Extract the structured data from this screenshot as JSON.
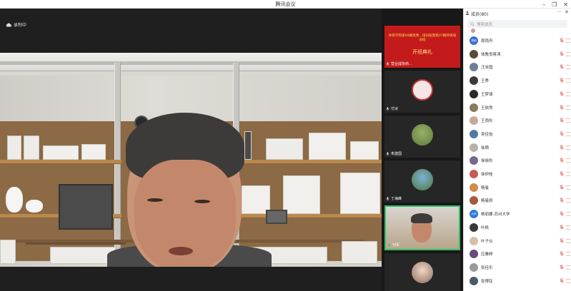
{
  "window": {
    "title": "腾讯会议"
  },
  "main": {
    "recording_label": "录制中"
  },
  "strip": {
    "tiles": [
      {
        "name": "营业成协商…",
        "banner_text": "体育学院第69期优秀…培训班暨第47期师资培训班",
        "banner_ceremony": "开班典礼"
      },
      {
        "name": "付冰"
      },
      {
        "name": "朱建国"
      },
      {
        "name": "丁海峰"
      },
      {
        "name": "刘军"
      },
      {
        "name": ""
      }
    ]
  },
  "panel": {
    "title": "成员(80)",
    "search_placeholder": "搜索成员",
    "members": [
      {
        "name": "周雨舟",
        "avatar_text": "周雨",
        "color": "#3a6fd8"
      },
      {
        "name": "体教员蒋涛",
        "avatar_text": "",
        "color": "#5a4a3a"
      },
      {
        "name": "汪米国",
        "avatar_text": "",
        "color": "#6a7f95"
      },
      {
        "name": "王秀",
        "avatar_text": "",
        "color": "#3a3a3a"
      },
      {
        "name": "王梦琦",
        "avatar_text": "",
        "color": "#2a2a2a"
      },
      {
        "name": "王依然",
        "avatar_text": "",
        "color": "#8c7a62"
      },
      {
        "name": "王雨彤",
        "avatar_text": "",
        "color": "#c9a89a"
      },
      {
        "name": "吴佳怡",
        "avatar_text": "",
        "color": "#4f7aa5"
      },
      {
        "name": "徐萌",
        "avatar_text": "",
        "color": "#b9b2a8"
      },
      {
        "name": "徐晓彤",
        "avatar_text": "",
        "color": "#7a6a8a"
      },
      {
        "name": "徐伊桂",
        "avatar_text": "",
        "color": "#c55a5a"
      },
      {
        "name": "杨曼",
        "avatar_text": "",
        "color": "#d08a4a"
      },
      {
        "name": "杨曼原",
        "avatar_text": "",
        "color": "#a55a3a"
      },
      {
        "name": "杨丽娜-苏州大学",
        "avatar_text": "大学",
        "color": "#2b7bd6"
      },
      {
        "name": "叶帆",
        "avatar_text": "",
        "color": "#3a3a3a"
      },
      {
        "name": "叶子仪",
        "avatar_text": "",
        "color": "#d7c0a8"
      },
      {
        "name": "应雅婷",
        "avatar_text": "",
        "color": "#6a4a7a"
      },
      {
        "name": "张佳乐",
        "avatar_text": "",
        "color": "#9a9a9a"
      },
      {
        "name": "张博钰",
        "avatar_text": "",
        "color": "#4a5a6a"
      }
    ]
  },
  "colors": {
    "accent": "#2fc26b",
    "muted_icon": "#e05454",
    "banner_red": "#c31b1b"
  }
}
